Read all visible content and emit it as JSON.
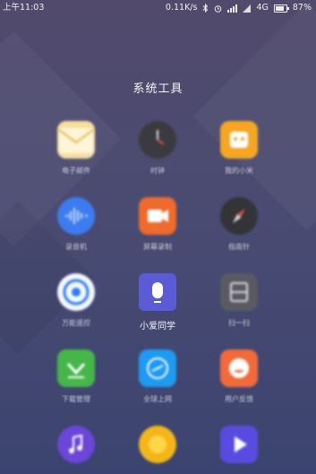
{
  "status_bar": {
    "time": "上午11:03",
    "speed": "0.11K/s",
    "network": "4G",
    "battery": "87%",
    "battery_level": 0.87
  },
  "folder": {
    "title": "系统工具"
  },
  "apps": [
    {
      "label": "电子邮件",
      "icon": "mail-icon",
      "color": "#f3d67a"
    },
    {
      "label": "时钟",
      "icon": "clock-icon",
      "color": "#3b3b40"
    },
    {
      "label": "我的小米",
      "icon": "mi-icon",
      "color": "#f5a623"
    },
    {
      "label": "录音机",
      "icon": "recorder-icon",
      "color": "#3d7cf0"
    },
    {
      "label": "屏幕录制",
      "icon": "screen-record-icon",
      "color": "#ee6a2d"
    },
    {
      "label": "指南针",
      "icon": "compass-icon",
      "color": "#333338"
    },
    {
      "label": "万能遥控",
      "icon": "remote-icon",
      "color": "#2f7ef0"
    },
    {
      "label": "小爱同学",
      "icon": "xiaoai-icon",
      "color": "#5b5bd6"
    },
    {
      "label": "扫一扫",
      "icon": "scan-icon",
      "color": "#5a5a62"
    },
    {
      "label": "下载管理",
      "icon": "download-icon",
      "color": "#46b64a"
    },
    {
      "label": "全球上网",
      "icon": "global-net-icon",
      "color": "#1e9af0"
    },
    {
      "label": "用户反馈",
      "icon": "feedback-icon",
      "color": "#f06a3a"
    },
    {
      "label": "",
      "icon": "music-icon",
      "color": "#6c46d8"
    },
    {
      "label": "",
      "icon": "sun-icon",
      "color": "#f2b618"
    },
    {
      "label": "",
      "icon": "video-icon",
      "color": "#5a4be0"
    }
  ]
}
